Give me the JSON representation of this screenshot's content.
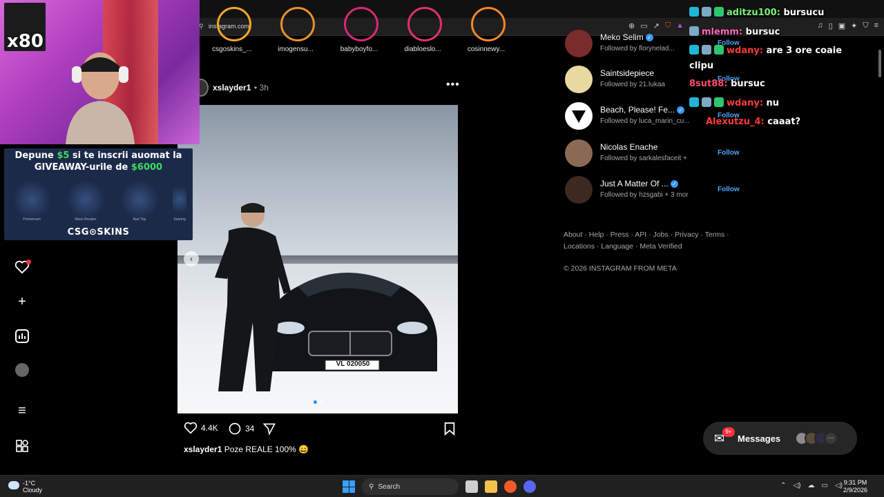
{
  "browser": {
    "url": "instagram.com"
  },
  "stories": [
    {
      "label": "csgoskins_..."
    },
    {
      "label": "imogensu..."
    },
    {
      "label": "babyboyfo..."
    },
    {
      "label": "diabloeslo..."
    },
    {
      "label": "cosinnewy..."
    }
  ],
  "post": {
    "username": "xslayder1",
    "time": "• 3h",
    "more": "•••",
    "plate": "VL 020050",
    "likes": "4.4K",
    "comments": "34",
    "caption_user": "xslayder1",
    "caption_text": "Poze REALE 100% 😄"
  },
  "suggestions": [
    {
      "name": "Meko Selim",
      "verified": true,
      "sub": "Followed by florynelad...",
      "follow": "Follow"
    },
    {
      "name": "Saintsidepiece",
      "verified": false,
      "sub": "Followed by 21.lukaa",
      "follow": "Follow"
    },
    {
      "name": "Beach, Please! Fe...",
      "verified": true,
      "sub": "Followed by luca_marin_cu...",
      "follow": "Follow"
    },
    {
      "name": "Nicolas Enache",
      "verified": false,
      "sub": "Followed by sarkalesfaceit +",
      "follow": "Follow"
    },
    {
      "name": "Just A Matter Of ...",
      "verified": true,
      "sub": "Followed by hzsgabi + 3 mor",
      "follow": "Follow"
    }
  ],
  "footer": {
    "links_line1": "About · Help · Press · API · Jobs · Privacy · Terms ·",
    "links_line2": "Locations · Language · Meta Verified",
    "copyright": "© 2026 INSTAGRAM FROM META"
  },
  "chat": [
    {
      "user": "aditzu100:",
      "msg": "bursucu",
      "ucls": "u1"
    },
    {
      "user": "mlemm:",
      "msg": "bursuc",
      "ucls": "u2"
    },
    {
      "user": "wdany:",
      "msg": "are 3 ore coaie",
      "ucls": "u3"
    },
    {
      "user": "",
      "msg": "clipu",
      "ucls": "u3"
    },
    {
      "user": "8sut88:",
      "msg": "bursuc",
      "ucls": "u4"
    },
    {
      "user": "wdany:",
      "msg": "nu",
      "ucls": "u3"
    },
    {
      "user": "Alexutzu_4:",
      "msg": "caaat?",
      "ucls": "u5"
    }
  ],
  "webcam": {
    "badge": "x80"
  },
  "ad": {
    "line1_pre": "Depune ",
    "line1_amount": "$5",
    "line1_post": " si te inscrii auomat la",
    "line2_pre": "GIVEAWAY-urile de ",
    "line2_amount": "$6000",
    "skins": [
      "Printstream",
      "Wave Breaker",
      "Bad Trip",
      "Searing"
    ],
    "logo": "CSG⊙SKINS"
  },
  "messages": {
    "label": "Messages",
    "badge": "9+"
  },
  "taskbar": {
    "temp": "-1°C",
    "weather": "Cloudy",
    "search": "Search",
    "time": "9:31 PM",
    "date": "2/9/2026"
  },
  "colors": {
    "accent_blue": "#4ea7ff",
    "notification_red": "#ff3040",
    "giveaway_green": "#3ddc5c"
  }
}
